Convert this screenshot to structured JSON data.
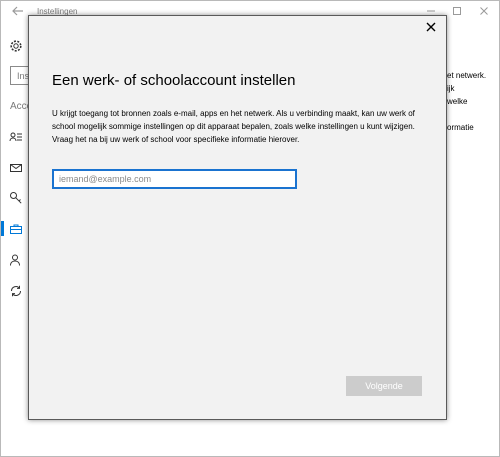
{
  "window": {
    "app_title": "Instellingen",
    "controls": [
      "minimize-icon",
      "maximize-icon",
      "close-icon"
    ]
  },
  "sidebar": {
    "search_stub": "Ins",
    "section_stub": "Acco",
    "icons": [
      "gear-icon",
      "person-card-icon",
      "mail-icon",
      "key-icon",
      "briefcase-icon",
      "person-icon",
      "sync-icon"
    ],
    "active_index": 4,
    "accent_color": "#0078d7"
  },
  "background_text": {
    "line1": "et netwerk.",
    "line2": "ijk",
    "line3": "welke",
    "line4": "ormatie"
  },
  "dialog": {
    "title": "Een werk- of schoolaccount instellen",
    "description": "U krijgt toegang tot bronnen zoals e-mail, apps en het netwerk. Als u verbinding maakt, kan uw werk of school mogelijk sommige instellingen op dit apparaat bepalen, zoals welke instellingen u kunt wijzigen. Vraag het na bij uw werk of school voor specifieke informatie hierover.",
    "email_placeholder": "iemand@example.com",
    "email_value": "",
    "next_label": "Volgende",
    "next_enabled": false
  }
}
